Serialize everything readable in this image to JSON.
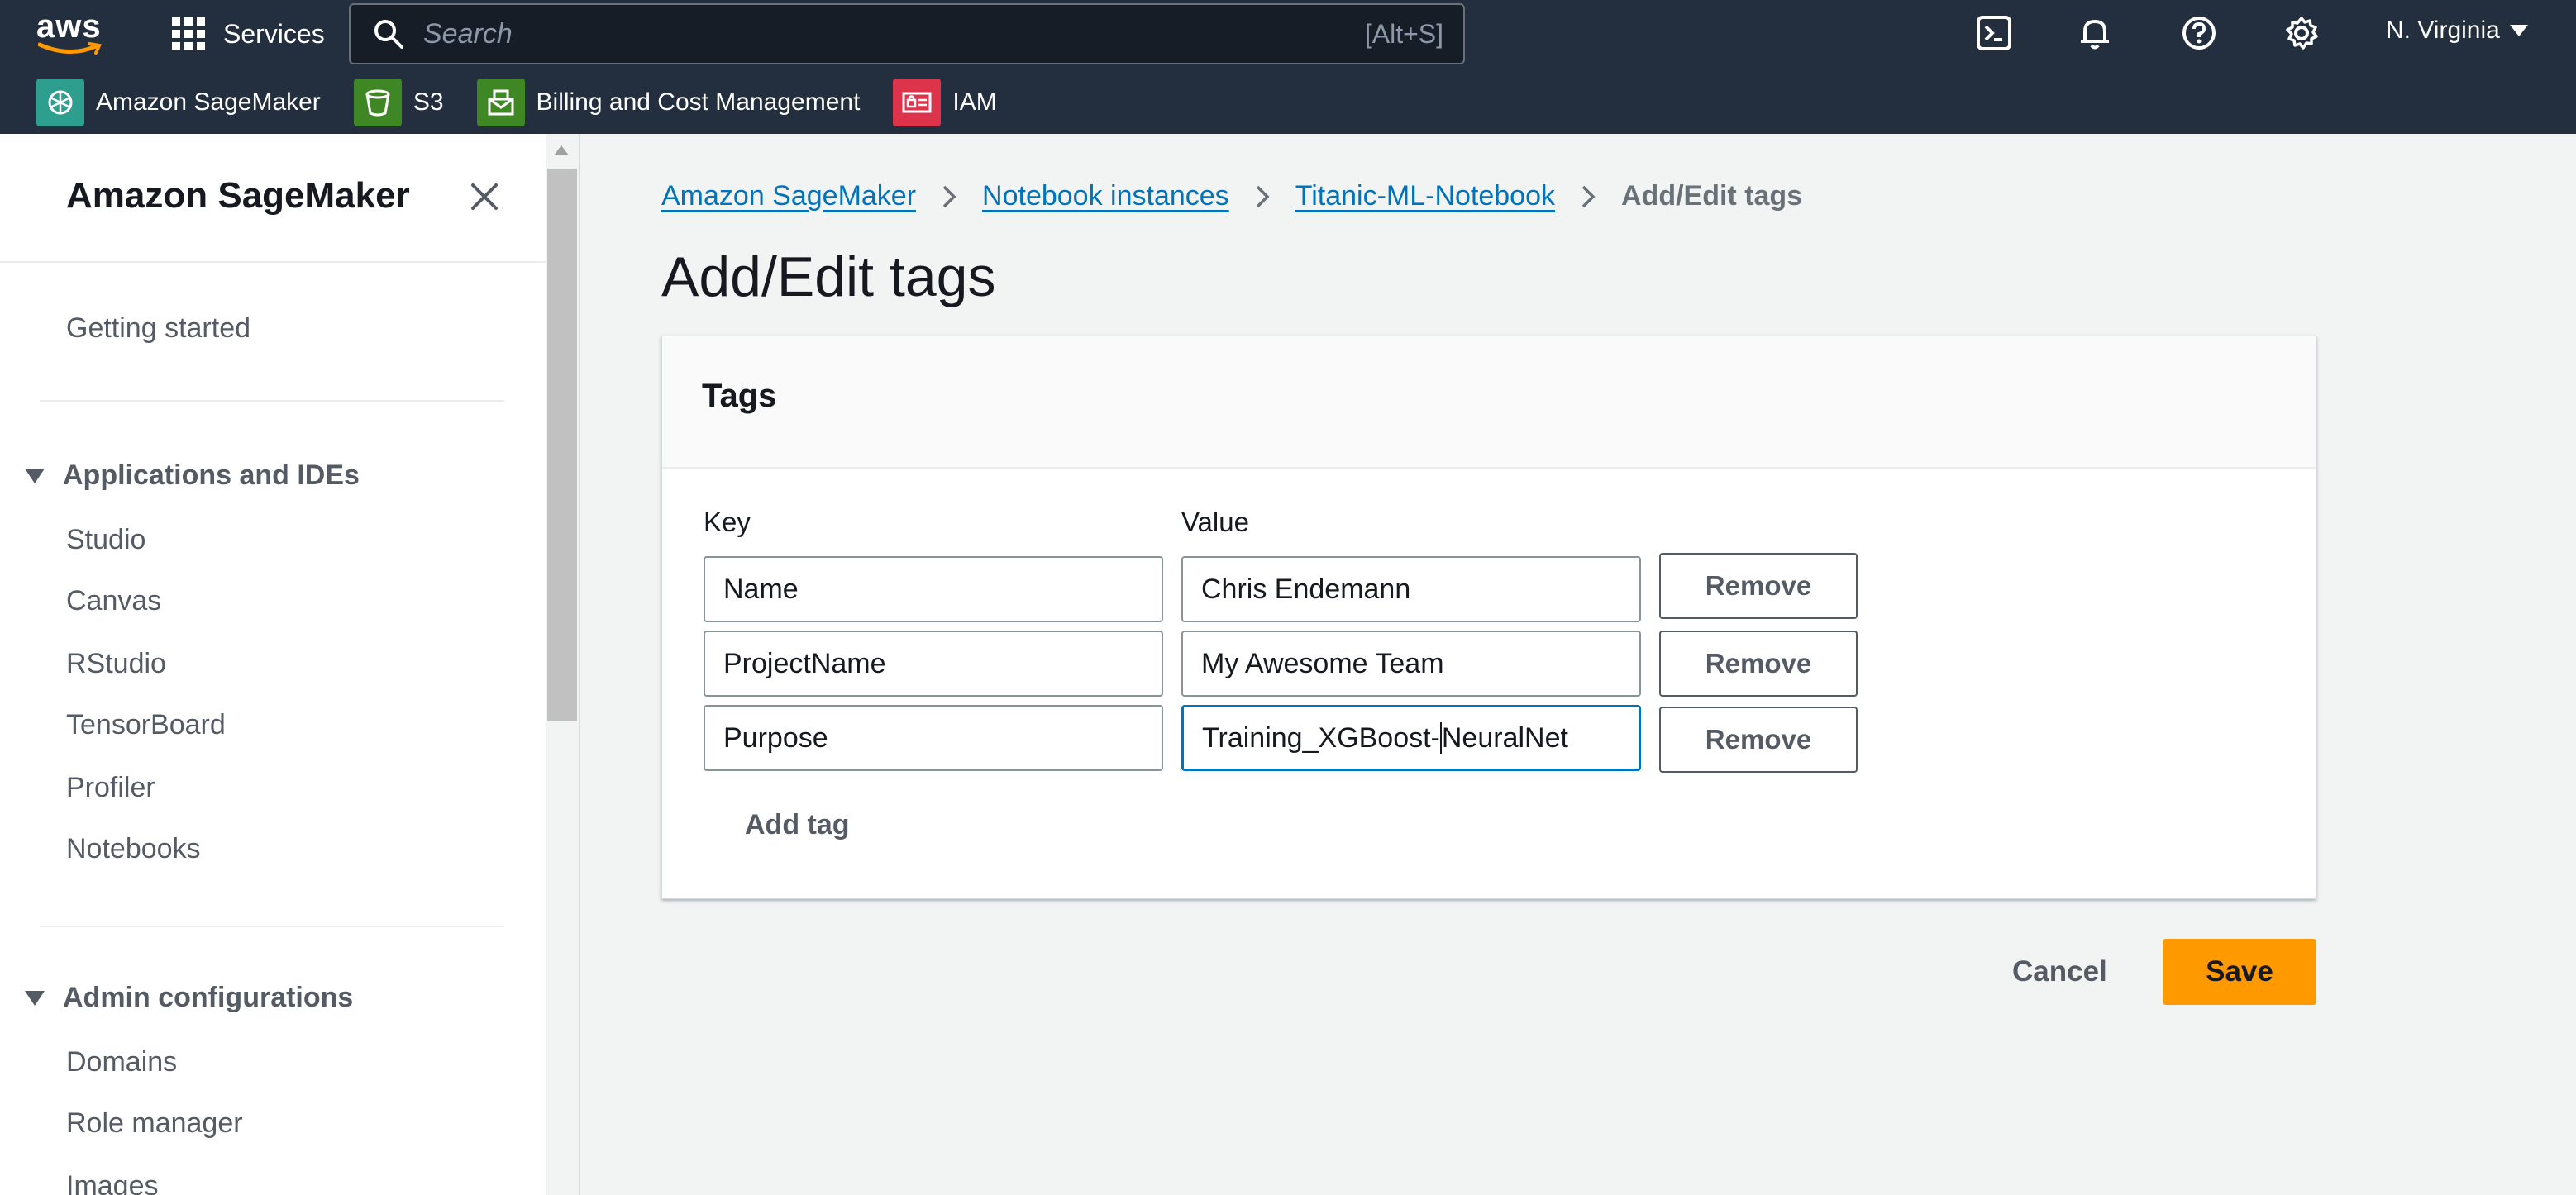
{
  "colors": {
    "nav_bg": "#232f3e",
    "link": "#0073bb",
    "primary": "#ff9900",
    "sagemaker": "#2e9e8f",
    "s3": "#3f8624",
    "billing": "#3f8624",
    "iam": "#dd344c"
  },
  "topbar": {
    "logo_text": "aws",
    "services_label": "Services",
    "search_placeholder": "Search",
    "search_shortcut": "[Alt+S]",
    "icons": [
      "cloudshell-icon",
      "bell-icon",
      "help-icon",
      "gear-icon"
    ],
    "region": "N. Virginia"
  },
  "favorites": [
    {
      "label": "Amazon SageMaker",
      "icon": "sagemaker-icon"
    },
    {
      "label": "S3",
      "icon": "s3-bucket-icon"
    },
    {
      "label": "Billing and Cost Management",
      "icon": "billing-icon"
    },
    {
      "label": "IAM",
      "icon": "iam-icon"
    }
  ],
  "sidebar": {
    "title": "Amazon SageMaker",
    "getting_started": "Getting started",
    "sections": [
      {
        "title": "Applications and IDEs",
        "items": [
          "Studio",
          "Canvas",
          "RStudio",
          "TensorBoard",
          "Profiler",
          "Notebooks"
        ]
      },
      {
        "title": "Admin configurations",
        "items": [
          "Domains",
          "Role manager",
          "Images"
        ]
      }
    ]
  },
  "breadcrumbs": [
    "Amazon SageMaker",
    "Notebook instances",
    "Titanic-ML-Notebook"
  ],
  "breadcrumb_current": "Add/Edit tags",
  "page_title": "Add/Edit tags",
  "panel": {
    "title": "Tags",
    "key_label": "Key",
    "value_label": "Value",
    "tags": [
      {
        "key": "Name",
        "value": "Chris Endemann"
      },
      {
        "key": "ProjectName",
        "value": "My Awesome Team"
      },
      {
        "key": "Purpose",
        "value_before_cursor": "Training_XGBoost-",
        "value_after_cursor": "NeuralNet"
      }
    ],
    "remove_label": "Remove",
    "add_tag_label": "Add tag"
  },
  "actions": {
    "cancel": "Cancel",
    "save": "Save"
  }
}
